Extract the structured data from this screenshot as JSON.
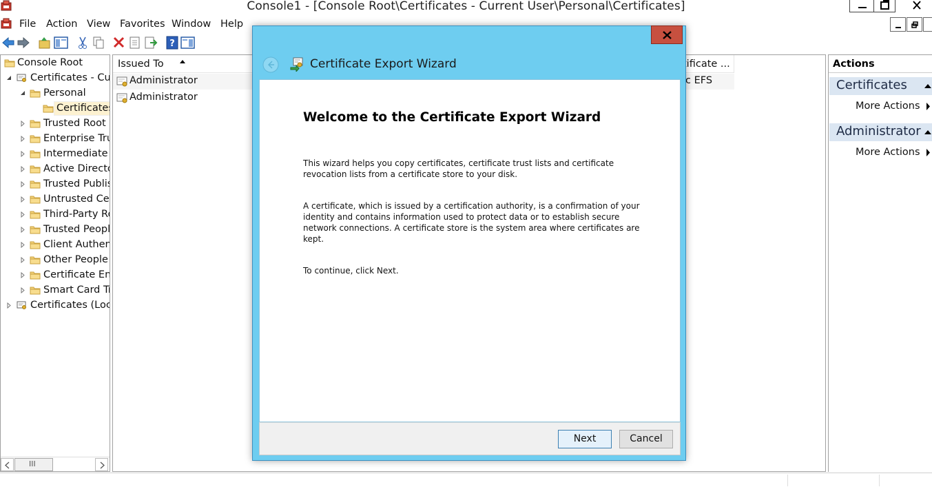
{
  "window": {
    "title": "Console1 - [Console Root\\Certificates - Current User\\Personal\\Certificates]"
  },
  "menu": {
    "items": [
      "File",
      "Action",
      "View",
      "Favorites",
      "Window",
      "Help"
    ]
  },
  "tree": {
    "items": [
      {
        "label": "Console Root",
        "level": 0,
        "expander": "none"
      },
      {
        "label": "Certificates - Curr",
        "level": 1,
        "expander": "expanded"
      },
      {
        "label": "Personal",
        "level": 2,
        "expander": "expanded"
      },
      {
        "label": "Certificates",
        "level": 3,
        "expander": "none",
        "selected": true
      },
      {
        "label": "Trusted Root C",
        "level": 2,
        "expander": "collapsed"
      },
      {
        "label": "Enterprise Trus",
        "level": 2,
        "expander": "collapsed"
      },
      {
        "label": "Intermediate C",
        "level": 2,
        "expander": "collapsed"
      },
      {
        "label": "Active Director",
        "level": 2,
        "expander": "collapsed"
      },
      {
        "label": "Trusted Publish",
        "level": 2,
        "expander": "collapsed"
      },
      {
        "label": "Untrusted Cert",
        "level": 2,
        "expander": "collapsed"
      },
      {
        "label": "Third-Party Ro",
        "level": 2,
        "expander": "collapsed"
      },
      {
        "label": "Trusted People",
        "level": 2,
        "expander": "collapsed"
      },
      {
        "label": "Client Authenti",
        "level": 2,
        "expander": "collapsed"
      },
      {
        "label": "Other People",
        "level": 2,
        "expander": "collapsed"
      },
      {
        "label": "Certificate Enro",
        "level": 2,
        "expander": "collapsed"
      },
      {
        "label": "Smart Card Tru",
        "level": 2,
        "expander": "collapsed"
      },
      {
        "label": "Certificates (Loca",
        "level": 1,
        "expander": "collapsed"
      }
    ],
    "scrollbar_thumb_glyph": "III"
  },
  "list": {
    "columns": {
      "issued_to": "Issued To",
      "intended": "tificate ..."
    },
    "rows": [
      {
        "issued_to": "Administrator",
        "intended": "ic EFS"
      },
      {
        "issued_to": "Administrator",
        "intended": ""
      }
    ]
  },
  "actions": {
    "title": "Actions",
    "sections": [
      {
        "title": "Certificates",
        "link": "More Actions"
      },
      {
        "title": "Administrator",
        "link": "More Actions"
      }
    ]
  },
  "wizard": {
    "title": "Certificate Export Wizard",
    "heading": "Welcome to the Certificate Export Wizard",
    "para1": "This wizard helps you copy certificates, certificate trust lists and certificate revocation lists from a certificate store to your disk.",
    "para2": "A certificate, which is issued by a certification authority, is a confirmation of your identity and contains information used to protect data or to establish secure network connections. A certificate store is the system area where certificates are kept.",
    "para3": "To continue, click Next.",
    "next_label": "Next",
    "cancel_label": "Cancel"
  },
  "colors": {
    "dialog_frame": "#6ecdf0",
    "close_button": "#c7503f",
    "actions_section_bg": "#dbe6f2",
    "next_button_border": "#3c7fb1"
  }
}
